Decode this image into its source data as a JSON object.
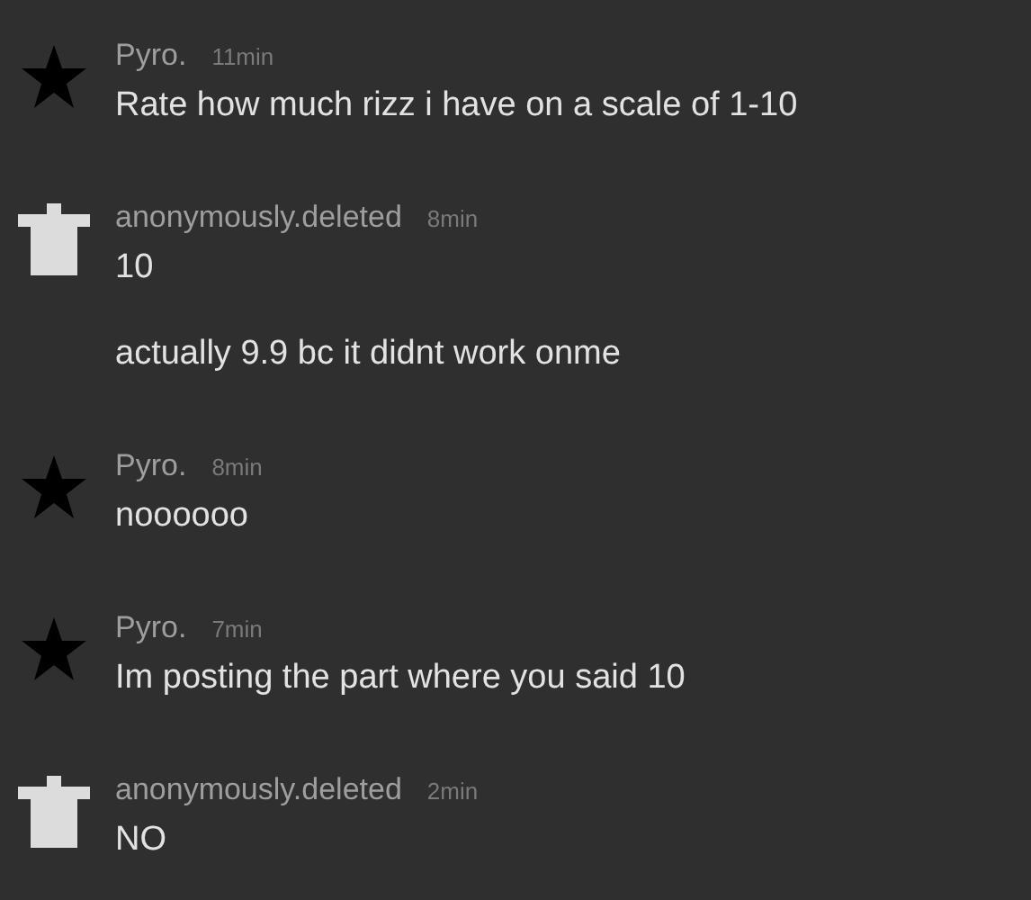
{
  "comments": [
    {
      "kind": "star",
      "username": "Pyro.",
      "time": "11min",
      "messages": [
        "Rate how much rizz i have on a scale of 1-10"
      ]
    },
    {
      "kind": "shirt",
      "username": "anonymously.deleted",
      "time": "8min",
      "messages": [
        "10",
        "actually 9.9 bc it didnt work onme"
      ]
    },
    {
      "kind": "star",
      "username": "Pyro.",
      "time": "8min",
      "messages": [
        "noooooo"
      ]
    },
    {
      "kind": "star",
      "username": "Pyro.",
      "time": "7min",
      "messages": [
        "Im posting the part where you said 10"
      ]
    },
    {
      "kind": "shirt",
      "username": "anonymously.deleted",
      "time": "2min",
      "messages": [
        "NO"
      ]
    }
  ]
}
